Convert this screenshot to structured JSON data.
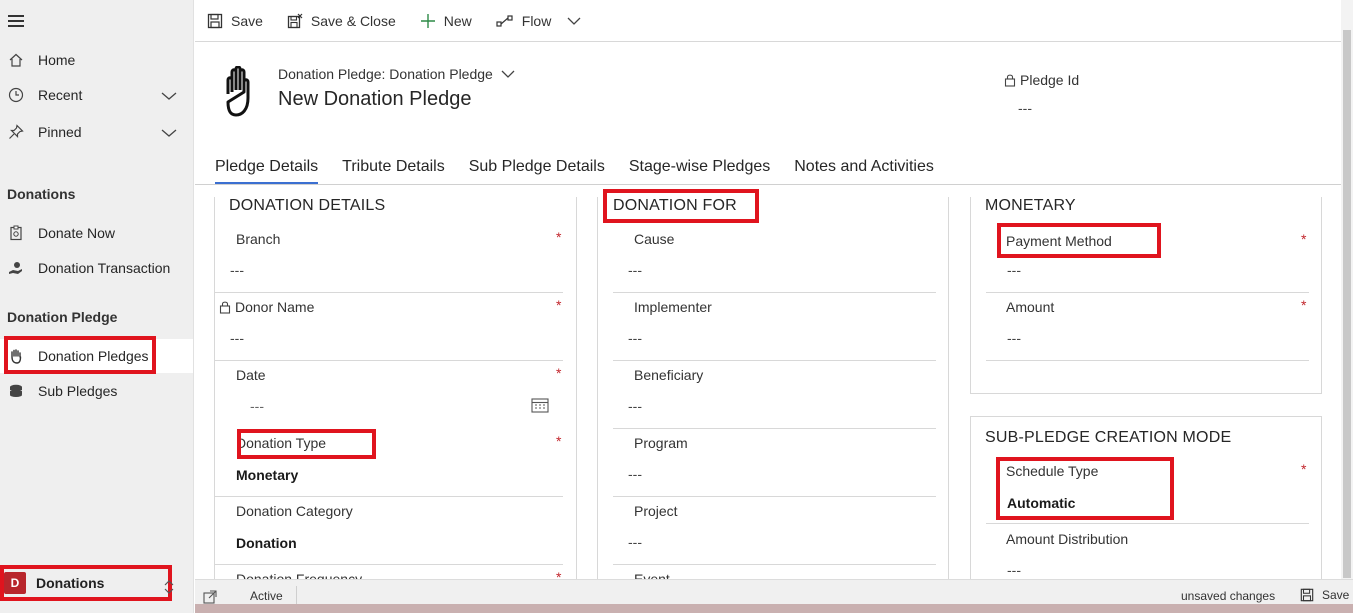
{
  "sidebar": {
    "home": "Home",
    "recent": "Recent",
    "pinned": "Pinned",
    "group1_title": "Donations",
    "donate_now": "Donate Now",
    "donation_transaction": "Donation Transaction",
    "group2_title": "Donation Pledge",
    "donation_pledges": "Donation Pledges",
    "sub_pledges": "Sub Pledges",
    "area_badge": "D",
    "area_label": "Donations"
  },
  "toolbar": {
    "save": "Save",
    "save_close": "Save & Close",
    "new": "New",
    "flow": "Flow"
  },
  "header": {
    "entity_form": "Donation Pledge: Donation Pledge",
    "title": "New Donation Pledge",
    "pledge_id_label": "Pledge Id",
    "pledge_id_value": "---"
  },
  "tabs": [
    "Pledge Details",
    "Tribute Details",
    "Sub Pledge Details",
    "Stage-wise Pledges",
    "Notes and Activities"
  ],
  "sections": {
    "donation_details": {
      "title": "DONATION DETAILS",
      "branch": {
        "label": "Branch",
        "value": "---",
        "required": "*"
      },
      "donor_name": {
        "label": "Donor Name",
        "value": "---",
        "required": "*"
      },
      "date": {
        "label": "Date",
        "value": "---",
        "required": "*"
      },
      "donation_type": {
        "label": "Donation Type",
        "value": "Monetary",
        "required": "*"
      },
      "donation_category": {
        "label": "Donation Category",
        "value": "Donation"
      },
      "donation_frequency": {
        "label": "Donation Frequency",
        "required": "*"
      }
    },
    "donation_for": {
      "title": "DONATION FOR",
      "cause": {
        "label": "Cause",
        "value": "---"
      },
      "implementer": {
        "label": "Implementer",
        "value": "---"
      },
      "beneficiary": {
        "label": "Beneficiary",
        "value": "---"
      },
      "program": {
        "label": "Program",
        "value": "---"
      },
      "project": {
        "label": "Project",
        "value": "---"
      },
      "event": {
        "label": "Event"
      }
    },
    "monetary": {
      "title": "MONETARY",
      "payment_method": {
        "label": "Payment Method",
        "value": "---",
        "required": "*"
      },
      "amount": {
        "label": "Amount",
        "value": "---",
        "required": "*"
      }
    },
    "sub_pledge_mode": {
      "title": "SUB-PLEDGE CREATION MODE",
      "schedule_type": {
        "label": "Schedule Type",
        "value": "Automatic",
        "required": "*"
      },
      "amount_distribution": {
        "label": "Amount Distribution",
        "value": "---"
      }
    }
  },
  "status": {
    "state": "Active",
    "unsaved": "unsaved changes",
    "save": "Save"
  },
  "colors": {
    "highlight": "#e0141e",
    "required": "#c2252c",
    "tab_underline": "#3b6fd1",
    "area_badge": "#b8262c"
  }
}
